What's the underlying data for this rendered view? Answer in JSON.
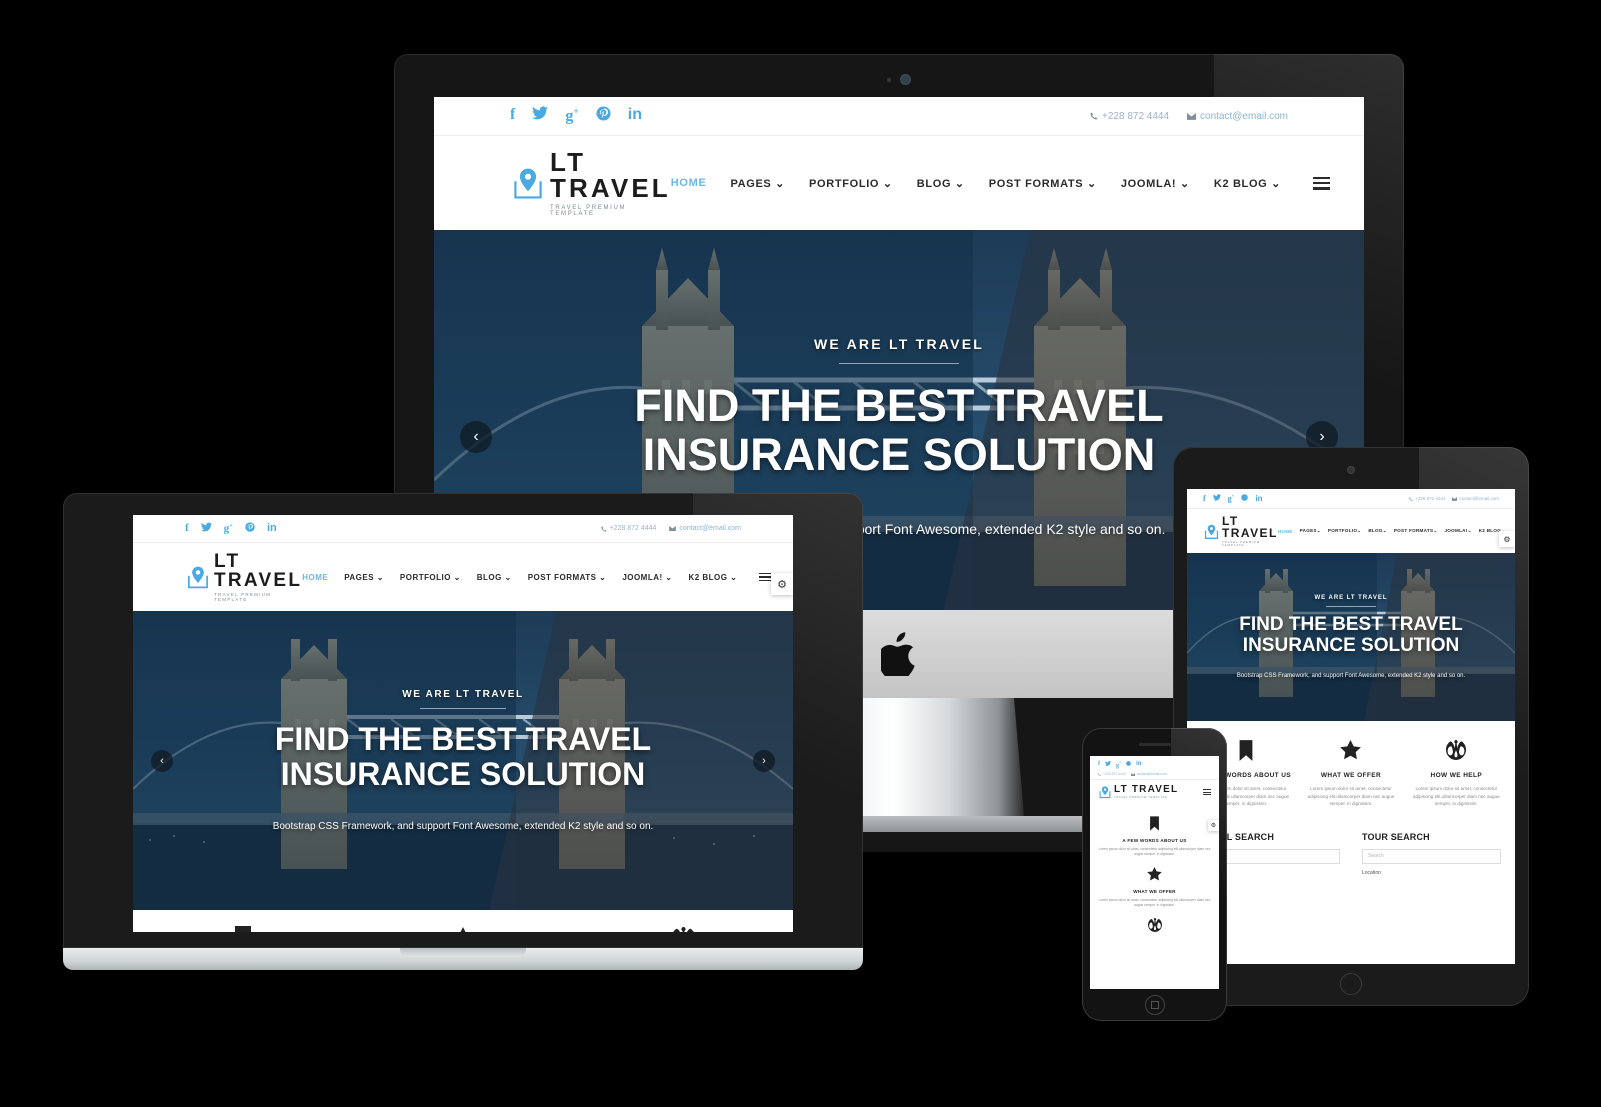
{
  "brand": {
    "name": "LT TRAVEL",
    "tagline": "TRAVEL PREMIUM TEMPLATE",
    "accent_color": "#49a9e0",
    "logo_icon": "map-pin-icon"
  },
  "topbar": {
    "social": [
      {
        "name": "facebook-icon",
        "glyph": "f"
      },
      {
        "name": "twitter-icon",
        "glyph": "🐦"
      },
      {
        "name": "google-plus-icon",
        "glyph": "g+"
      },
      {
        "name": "pinterest-icon",
        "glyph": "Ⓟ"
      },
      {
        "name": "linkedin-icon",
        "glyph": "in"
      }
    ],
    "phone": "+228 872 4444",
    "phone_icon": "phone-icon",
    "email": "contact@email.com",
    "email_icon": "envelope-icon"
  },
  "nav": {
    "items": [
      {
        "label": "HOME",
        "active": true,
        "caret": false
      },
      {
        "label": "PAGES",
        "active": false,
        "caret": true
      },
      {
        "label": "PORTFOLIO",
        "active": false,
        "caret": true
      },
      {
        "label": "BLOG",
        "active": false,
        "caret": true
      },
      {
        "label": "POST FORMATS",
        "active": false,
        "caret": true
      },
      {
        "label": "JOOMLA!",
        "active": false,
        "caret": true
      },
      {
        "label": "K2 BLOG",
        "active": false,
        "caret": true
      }
    ],
    "burger_icon": "hamburger-menu-icon"
  },
  "hero": {
    "kicker": "WE ARE LT TRAVEL",
    "title": "FIND THE BEST TRAVEL INSURANCE SOLUTION",
    "subtitle": "Bootstrap CSS Framework, and support Font Awesome, extended K2 style and so on.",
    "prev_icon": "chevron-left-icon",
    "next_icon": "chevron-right-icon",
    "settings_icon": "gear-icon",
    "background": "tower-bridge-night-photo"
  },
  "features": [
    {
      "icon": "bookmark-icon",
      "title": "A FEW WORDS ABOUT US",
      "text": "Lorem ipsum dolor sit amet, consectetur adipiscing elit.ullamcorper diam nec augue semper, in dignissim."
    },
    {
      "icon": "star-icon",
      "title": "WHAT WE OFFER",
      "text": "Lorem ipsum dolor sit amet, consectetur adipiscing elit.ullamcorper diam nec augue semper, in dignissim."
    },
    {
      "icon": "rebel-alliance-icon",
      "title": "HOW WE HELP",
      "text": "Lorem ipsum dolor sit amet, consectetur adipiscing elit.ullamcorper diam nec augue semper, in dignissim."
    }
  ],
  "search_band": [
    {
      "heading": "HOTEL SEARCH",
      "input_placeholder": "Search",
      "field_label": "Location"
    },
    {
      "heading": "TOUR SEARCH",
      "input_placeholder": "Search",
      "field_label": "Location"
    }
  ],
  "devices": {
    "imac": {
      "name": "imac-desktop",
      "logo_icon": "apple-logo-icon"
    },
    "macbook": {
      "name": "macbook-laptop"
    },
    "ipad": {
      "name": "ipad-tablet"
    },
    "iphone": {
      "name": "iphone-mobile"
    }
  }
}
